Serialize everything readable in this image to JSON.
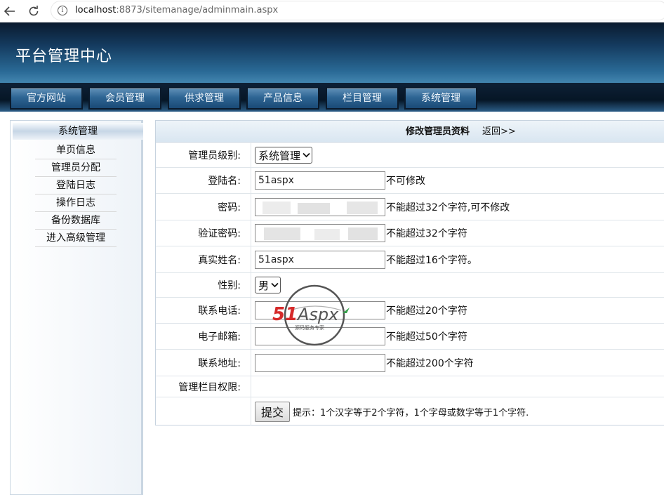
{
  "browser": {
    "url_host": "localhost",
    "url_rest": ":8873/sitemanage/adminmain.aspx",
    "info_glyph": "i"
  },
  "header": {
    "title": "平台管理中心",
    "nav": [
      "官方网站",
      "会员管理",
      "供求管理",
      "产品信息",
      "栏目管理",
      "系统管理"
    ]
  },
  "sidebar": {
    "heading": "系统管理",
    "items": [
      "单页信息",
      "管理员分配",
      "登陆日志",
      "操作日志",
      "备份数据库",
      "进入高级管理"
    ]
  },
  "form": {
    "title": "修改管理员资料",
    "back_link": "返回>>",
    "level": {
      "label": "管理员级别:",
      "value": "系统管理"
    },
    "login": {
      "label": "登陆名:",
      "value": "51aspx",
      "hint": "不可修改"
    },
    "password": {
      "label": "密码:",
      "hint": "不能超过32个字符,可不修改"
    },
    "confirm_password": {
      "label": "验证密码:",
      "hint": "不能超过32个字符"
    },
    "real_name": {
      "label": "真实姓名:",
      "value": "51aspx",
      "hint": "不能超过16个字符。"
    },
    "gender": {
      "label": "性别:",
      "value": "男"
    },
    "phone": {
      "label": "联系电话:",
      "value": "",
      "hint": "不能超过20个字符"
    },
    "email": {
      "label": "电子邮箱:",
      "value": "",
      "hint": "不能超过50个字符"
    },
    "address": {
      "label": "联系地址:",
      "value": "",
      "hint": "不能超过200个字符"
    },
    "permissions": {
      "label": "管理栏目权限:"
    },
    "submit_label": "提交",
    "submit_hint": "提示：1个汉字等于2个字符，1个字母或数字等于1个字符."
  },
  "watermark": {
    "brand_left": "51",
    "brand_right": "Aspx",
    "tagline": "源码服务专家"
  },
  "colors": {
    "header_dark": "#0a1a2e",
    "header_light": "#7fb6d8",
    "nav_button": "#2e6594",
    "watermark_red": "#d62a2a",
    "watermark_green": "#35a04a"
  }
}
